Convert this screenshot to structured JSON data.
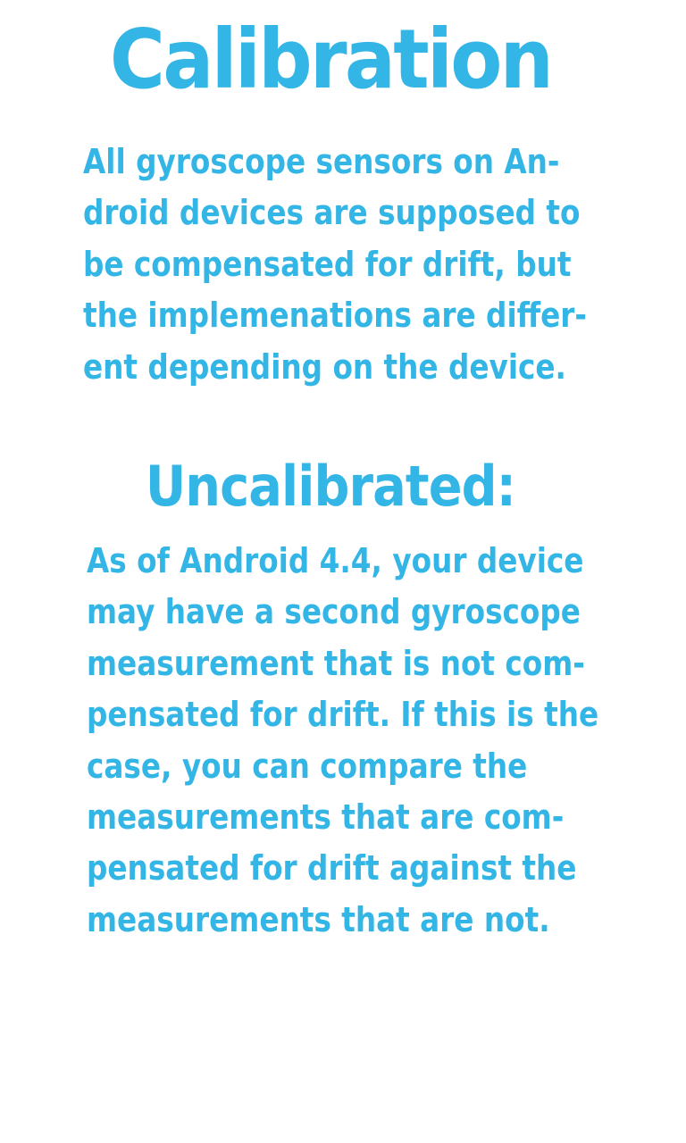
{
  "page": {
    "title": "Calibration",
    "intro_lines": [
      "All gyroscope sensors on An-",
      "droid devices are supposed to",
      "be compensated for drift, but",
      "the implemenations are differ-",
      "ent depending on the device."
    ],
    "subtitle": "Uncalibrated:",
    "body_lines": [
      "As of Android 4.4, your device",
      "may have a second gyroscope",
      "measurement that is not com-",
      "pensated for drift. If this is the",
      "case, you can compare the",
      "measurements that are com-",
      "pensated for drift against the",
      "measurements that are not."
    ]
  },
  "colors": {
    "accent": "#33b5e5",
    "background": "#ffffff"
  }
}
